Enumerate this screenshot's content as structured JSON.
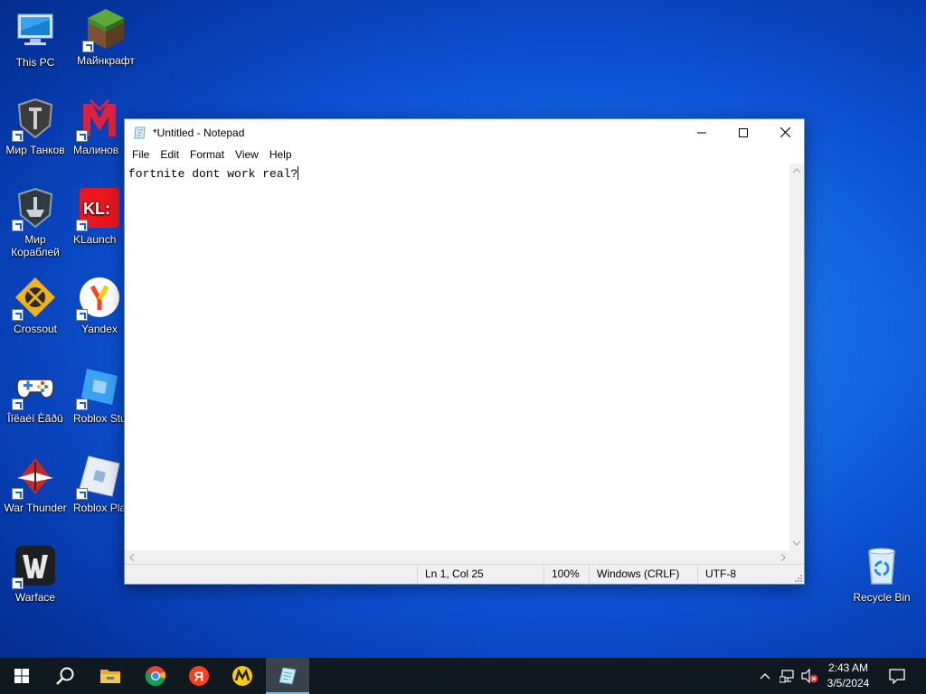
{
  "desktop": {
    "icons": [
      {
        "label": "This PC"
      },
      {
        "label": "Майнкрафт"
      },
      {
        "label": "Мир Танков"
      },
      {
        "label": "Малинов"
      },
      {
        "label": "Мир Кораблей"
      },
      {
        "label": "KLaunch"
      },
      {
        "label": "Crossout"
      },
      {
        "label": "Yandex"
      },
      {
        "label": "Îîëaéí Èãðû"
      },
      {
        "label": "Roblox Stu"
      },
      {
        "label": "War Thunder"
      },
      {
        "label": "Roblox Pla"
      },
      {
        "label": "Warface"
      },
      {
        "label": "Recycle Bin"
      }
    ]
  },
  "notepad": {
    "title": "*Untitled - Notepad",
    "menu": [
      "File",
      "Edit",
      "Format",
      "View",
      "Help"
    ],
    "content": "fortnite dont work real?",
    "status": {
      "position": "Ln 1, Col 25",
      "zoom": "100%",
      "line_ending": "Windows (CRLF)",
      "encoding": "UTF-8"
    }
  },
  "taskbar": {
    "time": "2:43 AM",
    "date": "3/5/2024"
  },
  "colors": {
    "accent": "#76b9ed",
    "taskbar": "#101820"
  }
}
